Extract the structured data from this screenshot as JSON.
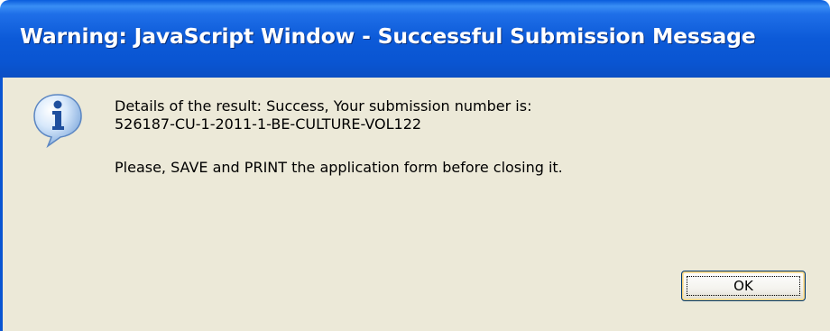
{
  "window": {
    "title": "Warning: JavaScript Window - Successful Submission Message"
  },
  "dialog": {
    "icon": "info-icon",
    "message_lines": [
      "Details of the result: Success, Your submission number is:",
      "526187-CU-1-2011-1-BE-CULTURE-VOL122",
      "Please, SAVE and PRINT the application form before closing it."
    ],
    "ok_label": "OK"
  },
  "colors": {
    "title_bar": "#0a55d2",
    "dialog_background": "#ece9d8",
    "button_border": "#003c74"
  }
}
